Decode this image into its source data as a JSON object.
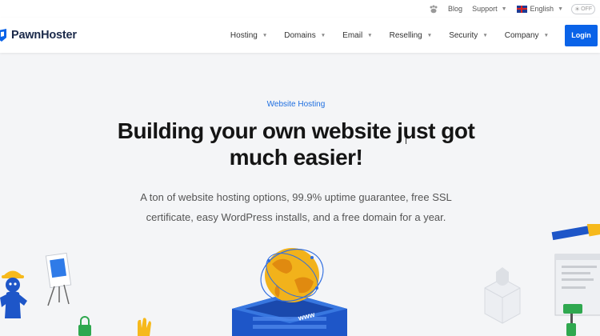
{
  "topbar": {
    "blog": "Blog",
    "support": "Support",
    "language": "English",
    "toggle": "OFF"
  },
  "brand": {
    "name": "PawnHoster"
  },
  "nav": {
    "items": [
      {
        "label": "Hosting"
      },
      {
        "label": "Domains"
      },
      {
        "label": "Email"
      },
      {
        "label": "Reselling"
      },
      {
        "label": "Security"
      },
      {
        "label": "Company"
      }
    ],
    "login": "Login"
  },
  "hero": {
    "eyebrow": "Website Hosting",
    "headline_line1": "Building your own website just got",
    "headline_line2": "much easier!",
    "sub_line1": "A ton of website hosting options, 99.9% uptime guarantee, free SSL",
    "sub_line2": "certificate, easy WordPress installs, and a free domain for a year."
  },
  "illustration": {
    "box_label": "www"
  },
  "colors": {
    "accent": "#0a63e8",
    "eyebrow": "#1f6fe0",
    "globe": "#f2b21b",
    "server": "#1e56c8"
  }
}
